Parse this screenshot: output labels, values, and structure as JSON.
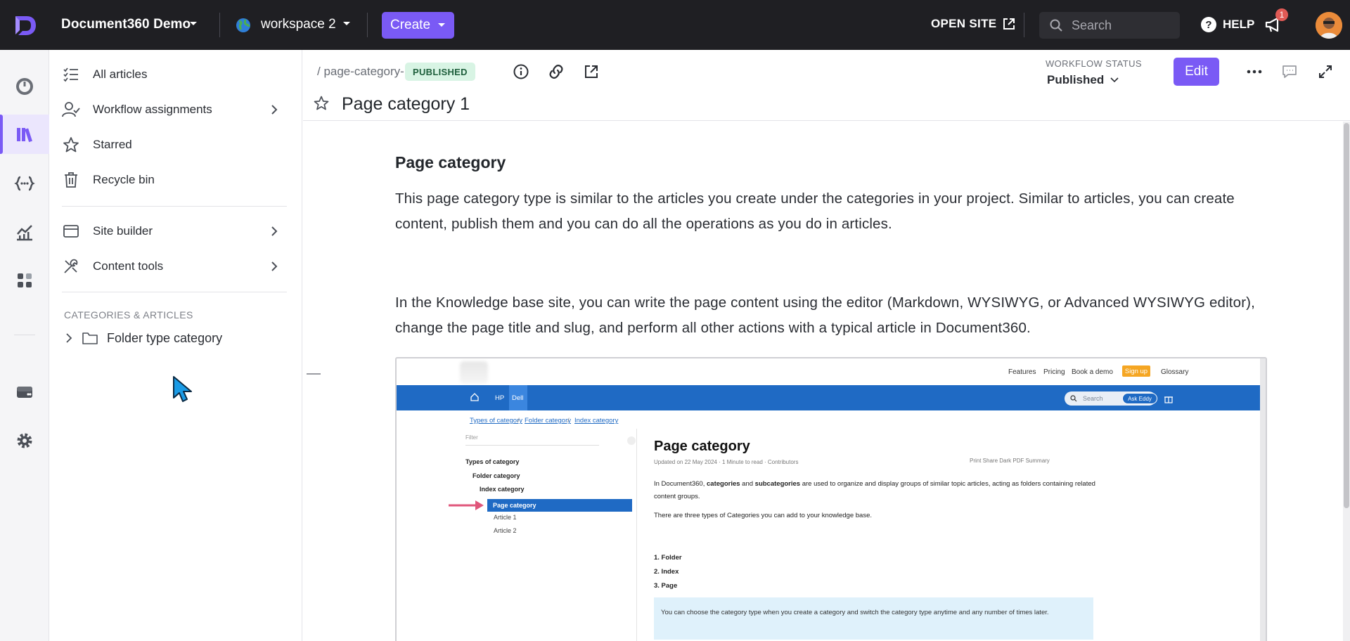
{
  "topbar": {
    "project_name": "Document360 Demo",
    "workspace_name": "workspace 2",
    "create_label": "Create",
    "open_site_label": "OPEN SITE",
    "search_placeholder": "Search",
    "help_label": "HELP",
    "notification_count": "1"
  },
  "rail": {
    "items": [
      "dashboard-icon",
      "documentation-icon",
      "api-icon",
      "analytics-icon",
      "apps-icon",
      "drive-icon",
      "settings-icon"
    ],
    "active": "documentation-icon"
  },
  "nav": {
    "items": [
      {
        "label": "All articles",
        "icon": "list-check-icon"
      },
      {
        "label": "Workflow assignments",
        "icon": "user-check-icon"
      },
      {
        "label": "Starred",
        "icon": "star-icon"
      },
      {
        "label": "Recycle bin",
        "icon": "trash-icon"
      },
      {
        "label": "Site builder",
        "icon": "browser-window-icon"
      },
      {
        "label": "Content tools",
        "icon": "tools-icon"
      }
    ],
    "section_title": "CATEGORIES & ARTICLES",
    "tree_item": "Folder type category"
  },
  "article": {
    "slug": "/ page-category-1",
    "status": "PUBLISHED",
    "workflow_label": "WORKFLOW STATUS",
    "workflow_value": "Published",
    "edit_label": "Edit",
    "title": "Page category 1",
    "heading": "Page category",
    "para1": "This page category type is similar to the articles you create under the categories in your project. Similar to articles, you can create content, publish them and you can do all the operations as you do in articles.",
    "para2": "In the Knowledge base site, you can write the page content using the editor (Markdown, WYSIWYG, or Advanced WYSIWYG editor), change the page title and slug, and perform all other actions with a typical article in Document360."
  },
  "embedded": {
    "toplinks": [
      "Features",
      "Pricing",
      "Book a demo"
    ],
    "signup": "Sign up",
    "glossary": "Glossary",
    "navlinks": [
      "HP",
      "Dell"
    ],
    "search_placeholder": "Search",
    "ask": "Ask Eddy",
    "breadcrumbs": [
      "Types of category",
      "Folder category",
      "Index category"
    ],
    "filter_placeholder": "Filter",
    "tree": [
      "Types of category",
      "Folder category",
      "Index category",
      "Page category",
      "Article 1",
      "Article 2"
    ],
    "h1": "Page category",
    "meta": "Updated on 22 May 2024 · 1 Minute to read · Contributors",
    "actions": "Print   Share   Dark   PDF   Summary",
    "p1_a": "In Document360, ",
    "p1_b": "categories",
    "p1_c": " and ",
    "p1_d": "subcategories",
    "p1_e": " are used to organize and display groups of similar topic articles, acting as folders containing related content groups.",
    "p2": "There are three types of Categories you can add to your knowledge base.",
    "list": [
      "1. Folder",
      "2. Index",
      "3. Page"
    ],
    "note": "You can choose the category type when you create a category and switch the category type anytime and any number of times later."
  },
  "colors": {
    "accent": "#7a5af5",
    "topbar": "#1f1f23",
    "published_bg": "#d8f4e4",
    "kb_blue": "#1f6ac4"
  }
}
